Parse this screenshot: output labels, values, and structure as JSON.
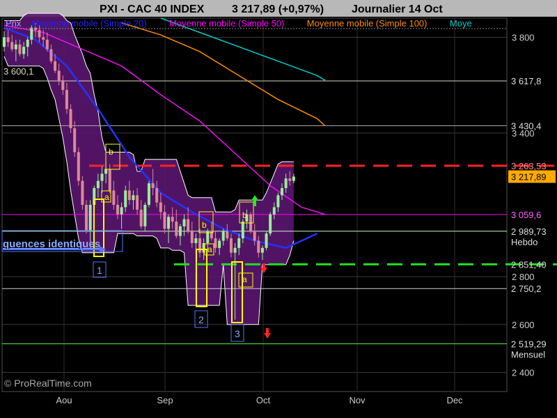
{
  "header": {
    "symbol": "PXI - CAC 40 INDEX",
    "price": "3 217,89 (+0,97%)",
    "period": "Journalier  14 Oct"
  },
  "legend": [
    {
      "label": "Prix",
      "color": "#a0a0ff"
    },
    {
      "label": "Moyenne mobile (Simple 20)",
      "color": "#2222ff"
    },
    {
      "label": "Moyenne mobile (Simple 50)",
      "color": "#ff00ff"
    },
    {
      "label": "Moyenne mobile (Simple 100)",
      "color": "#ff8800"
    },
    {
      "label": "Moye",
      "color": "#00cccc"
    }
  ],
  "watermark": "© ProRealTime.com",
  "annotation_text": "quences identiques",
  "marker_labels": {
    "a": "a",
    "b": "b",
    "one": "1",
    "two": "2",
    "three": "3"
  },
  "chart_data": {
    "type": "candlestick",
    "ylim": [
      2320,
      3880
    ],
    "x_labels": [
      "Aou",
      "Sep",
      "Oct",
      "Nov",
      "Dec"
    ],
    "y_ticks": [
      2400,
      2600,
      2800,
      3400,
      3800
    ],
    "y_tick_labels": [
      "2 400",
      "2 600",
      "2 800",
      "3 400",
      "3 800"
    ],
    "price_levels": [
      {
        "value": 3617.8,
        "label": "3 617,8",
        "note": "",
        "color": "#d8d8c0",
        "dash": false
      },
      {
        "value": 3430.4,
        "label": "3 430,4",
        "note": "",
        "color": "#a8a8a8",
        "dash": false
      },
      {
        "value": 3263.53,
        "label": "3 263,53",
        "note": "",
        "color": "#ff2222",
        "dash": true
      },
      {
        "value": 3059.6,
        "label": "3 059,6",
        "note": "",
        "color": "#ff00ff",
        "dash": false
      },
      {
        "value": 2989.73,
        "label": "2 989,73",
        "note": "Hebdo",
        "color": "#c0ffc0",
        "dash": false
      },
      {
        "value": 2851.4,
        "label": "2 851,40",
        "note": "",
        "color": "#22dd22",
        "dash": true
      },
      {
        "value": 2750.2,
        "label": "2 750,2",
        "note": "",
        "color": "#d0d0d0",
        "dash": false
      },
      {
        "value": 2519.29,
        "label": "2 519,29",
        "note": "Mensuel",
        "color": "#55ee44",
        "dash": false
      }
    ],
    "last_price": {
      "value": 3217.89,
      "label": "3 217,89"
    },
    "left_label": "3 600,1",
    "candles": [
      [
        3760,
        3825,
        3740,
        3800
      ],
      [
        3800,
        3830,
        3760,
        3780
      ],
      [
        3780,
        3810,
        3740,
        3750
      ],
      [
        3750,
        3790,
        3700,
        3770
      ],
      [
        3770,
        3790,
        3720,
        3730
      ],
      [
        3730,
        3780,
        3710,
        3760
      ],
      [
        3760,
        3800,
        3720,
        3790
      ],
      [
        3790,
        3850,
        3770,
        3840
      ],
      [
        3840,
        3860,
        3800,
        3830
      ],
      [
        3830,
        3850,
        3780,
        3800
      ],
      [
        3800,
        3830,
        3760,
        3790
      ],
      [
        3790,
        3820,
        3740,
        3750
      ],
      [
        3750,
        3770,
        3690,
        3700
      ],
      [
        3700,
        3730,
        3650,
        3660
      ],
      [
        3660,
        3690,
        3600,
        3620
      ],
      [
        3620,
        3640,
        3560,
        3580
      ],
      [
        3580,
        3610,
        3480,
        3500
      ],
      [
        3500,
        3520,
        3400,
        3420
      ],
      [
        3420,
        3450,
        3300,
        3320
      ],
      [
        3320,
        3340,
        3180,
        3200
      ],
      [
        3200,
        3220,
        3080,
        3100
      ],
      [
        3100,
        3120,
        2980,
        2990
      ],
      [
        2990,
        3120,
        2920,
        3100
      ],
      [
        3100,
        3180,
        3060,
        3170
      ],
      [
        3170,
        3230,
        3130,
        3200
      ],
      [
        3200,
        3260,
        3150,
        3230
      ],
      [
        3230,
        3280,
        3190,
        3250
      ],
      [
        3250,
        3270,
        3150,
        3160
      ],
      [
        3160,
        3200,
        3080,
        3100
      ],
      [
        3100,
        3140,
        3040,
        3060
      ],
      [
        3060,
        3110,
        3000,
        3090
      ],
      [
        3090,
        3180,
        3070,
        3160
      ],
      [
        3160,
        3200,
        3100,
        3120
      ],
      [
        3120,
        3160,
        3080,
        3140
      ],
      [
        3140,
        3170,
        3060,
        3080
      ],
      [
        3080,
        3120,
        3000,
        3010
      ],
      [
        3010,
        3110,
        2990,
        3100
      ],
      [
        3100,
        3200,
        3090,
        3190
      ],
      [
        3190,
        3250,
        3140,
        3170
      ],
      [
        3170,
        3200,
        3090,
        3110
      ],
      [
        3110,
        3150,
        3040,
        3070
      ],
      [
        3070,
        3100,
        2980,
        3000
      ],
      [
        3000,
        3060,
        2940,
        3050
      ],
      [
        3050,
        3090,
        3000,
        3030
      ],
      [
        3030,
        3080,
        2960,
        2970
      ],
      [
        2970,
        3020,
        2930,
        3010
      ],
      [
        3010,
        3060,
        2970,
        3040
      ],
      [
        3040,
        3090,
        2980,
        2990
      ],
      [
        2990,
        3030,
        2920,
        2940
      ],
      [
        2940,
        2980,
        2700,
        2960
      ],
      [
        2960,
        3000,
        2880,
        2900
      ],
      [
        2900,
        2960,
        2870,
        2940
      ],
      [
        2940,
        3000,
        2910,
        2990
      ],
      [
        2990,
        3030,
        2950,
        2960
      ],
      [
        2960,
        2990,
        2900,
        2920
      ],
      [
        2920,
        2960,
        2890,
        2950
      ],
      [
        2950,
        3000,
        2930,
        2990
      ],
      [
        2990,
        3020,
        2950,
        2960
      ],
      [
        2960,
        2980,
        2880,
        2900
      ],
      [
        2900,
        2940,
        2620,
        2920
      ],
      [
        2920,
        2980,
        2890,
        2960
      ],
      [
        2960,
        3040,
        2940,
        3030
      ],
      [
        3030,
        3080,
        3000,
        3060
      ],
      [
        3060,
        3070,
        2980,
        2990
      ],
      [
        2990,
        3020,
        2930,
        2950
      ],
      [
        2950,
        2970,
        2880,
        2900
      ],
      [
        2900,
        2930,
        2870,
        2920
      ],
      [
        2920,
        2990,
        2910,
        2980
      ],
      [
        2980,
        3070,
        2970,
        3060
      ],
      [
        3060,
        3110,
        3040,
        3090
      ],
      [
        3090,
        3150,
        3070,
        3140
      ],
      [
        3140,
        3190,
        3120,
        3170
      ],
      [
        3170,
        3230,
        3150,
        3210
      ],
      [
        3210,
        3240,
        3180,
        3200
      ],
      [
        3200,
        3230,
        3190,
        3218
      ]
    ],
    "series": [
      {
        "name": "Moyenne mobile (Simple 20)",
        "color": "#2233ff",
        "values": [
          [
            0,
            3840
          ],
          [
            8,
            3790
          ],
          [
            16,
            3680
          ],
          [
            24,
            3500
          ],
          [
            32,
            3300
          ],
          [
            40,
            3150
          ],
          [
            48,
            3070
          ],
          [
            56,
            3000
          ],
          [
            64,
            2950
          ],
          [
            72,
            2920
          ],
          [
            80,
            2980
          ]
        ]
      },
      {
        "name": "Moyenne mobile (Simple 50)",
        "color": "#ee11ee",
        "values": [
          [
            0,
            3850
          ],
          [
            10,
            3820
          ],
          [
            20,
            3750
          ],
          [
            30,
            3680
          ],
          [
            40,
            3560
          ],
          [
            50,
            3450
          ],
          [
            60,
            3300
          ],
          [
            68,
            3180
          ],
          [
            76,
            3090
          ],
          [
            82,
            3060
          ]
        ]
      },
      {
        "name": "Moyenne mobile (Simple 100)",
        "color": "#ff8800",
        "values": [
          [
            30,
            3860
          ],
          [
            40,
            3810
          ],
          [
            50,
            3740
          ],
          [
            60,
            3640
          ],
          [
            70,
            3540
          ],
          [
            80,
            3460
          ],
          [
            82,
            3430
          ]
        ]
      },
      {
        "name": "Moye",
        "color": "#00cccc",
        "values": [
          [
            40,
            3880
          ],
          [
            50,
            3820
          ],
          [
            60,
            3760
          ],
          [
            70,
            3700
          ],
          [
            80,
            3640
          ],
          [
            82,
            3620
          ]
        ]
      }
    ]
  }
}
